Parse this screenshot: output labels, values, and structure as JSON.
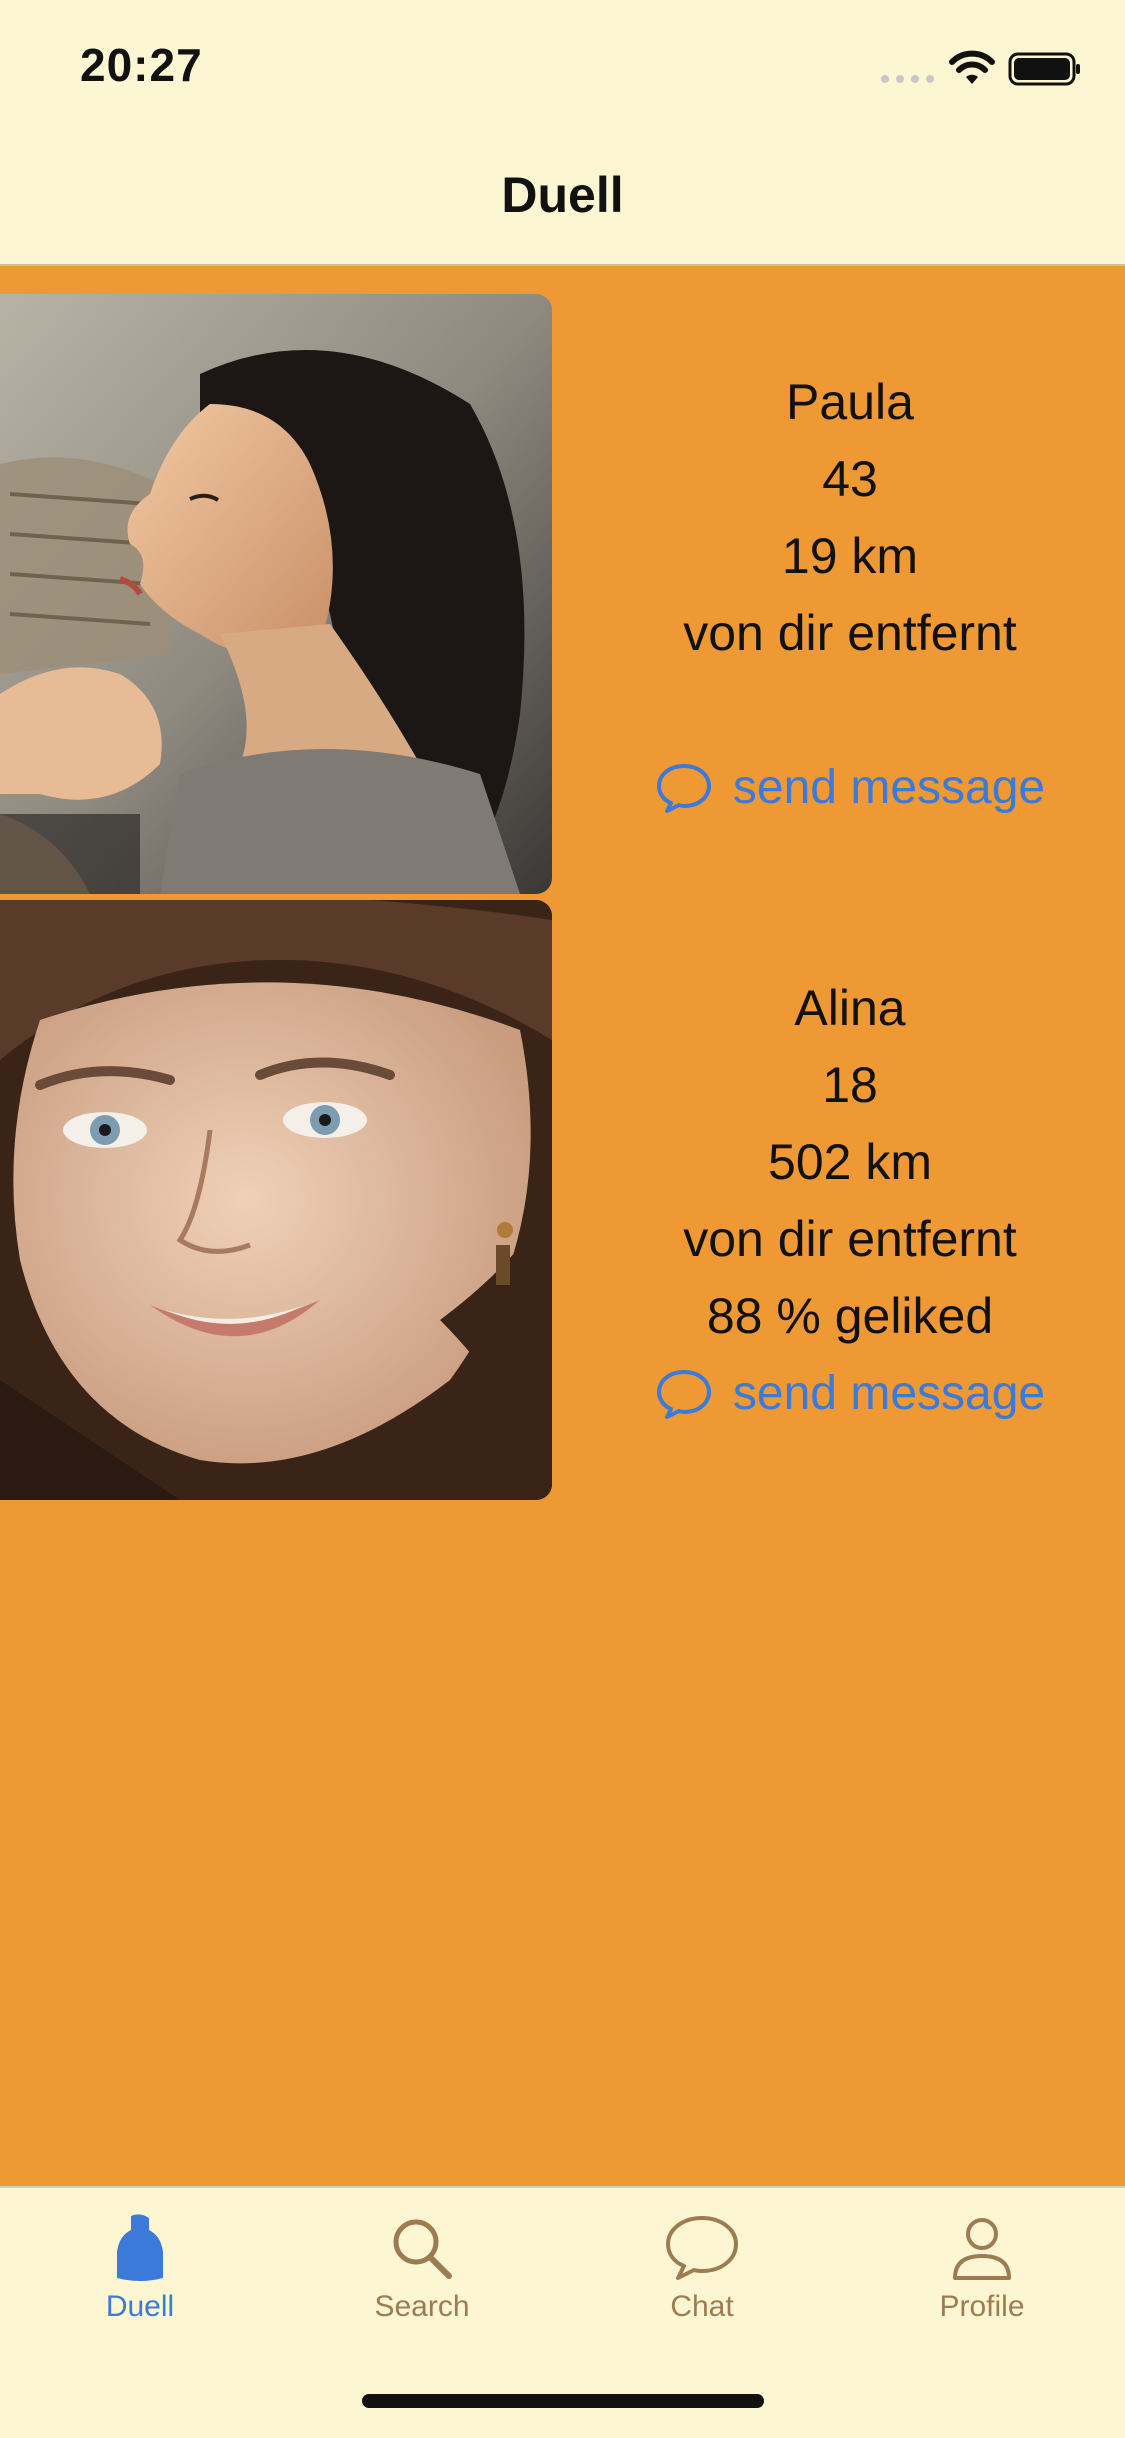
{
  "status_bar": {
    "time": "20:27"
  },
  "nav": {
    "title": "Duell"
  },
  "colors": {
    "background": "#ef9934",
    "bar_background": "#fdf6d2",
    "accent": "#3b7ad9",
    "inactive_tab": "#9d7c52"
  },
  "profiles": [
    {
      "name": "Paula",
      "age": "43",
      "distance": "19 km",
      "distance_note": "von dir entfernt",
      "like_rate": "",
      "message_label": "send message"
    },
    {
      "name": "Alina",
      "age": "18",
      "distance": "502 km",
      "distance_note": "von dir entfernt",
      "like_rate": "88 % geliked",
      "message_label": "send message"
    }
  ],
  "tabs": [
    {
      "label": "Duell",
      "icon": "duell-icon",
      "active": true
    },
    {
      "label": "Search",
      "icon": "search-icon",
      "active": false
    },
    {
      "label": "Chat",
      "icon": "chat-icon",
      "active": false
    },
    {
      "label": "Profile",
      "icon": "profile-icon",
      "active": false
    }
  ]
}
